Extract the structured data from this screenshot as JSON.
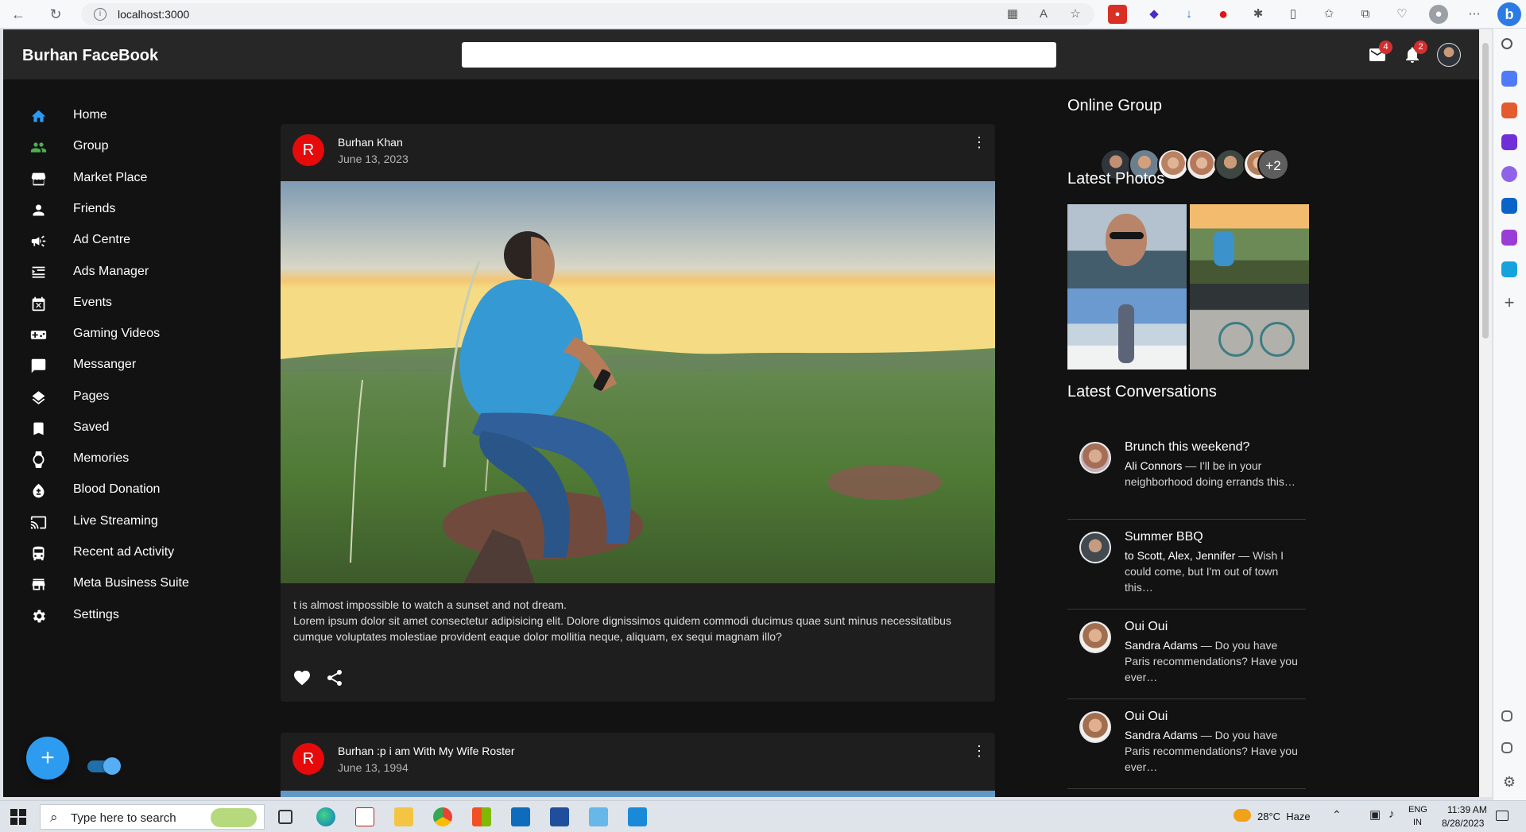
{
  "browser": {
    "url": "localhost:3000",
    "back_icon": "arrow-left-icon",
    "reload_icon": "reload-icon",
    "bing_label": "b"
  },
  "app": {
    "brand": "Burhan FaceBook",
    "search_placeholder": "",
    "mail_badge": "4",
    "notification_badge": "2"
  },
  "nav": {
    "items": [
      {
        "label": "Home",
        "icon": "home-icon"
      },
      {
        "label": "Group",
        "icon": "group-icon"
      },
      {
        "label": "Market Place",
        "icon": "store-icon"
      },
      {
        "label": "Friends",
        "icon": "person-icon"
      },
      {
        "label": "Ad Centre",
        "icon": "campaign-icon"
      },
      {
        "label": "Ads Manager",
        "icon": "list-icon"
      },
      {
        "label": "Events",
        "icon": "event-icon"
      },
      {
        "label": "Gaming Videos",
        "icon": "gamepad-icon"
      },
      {
        "label": "Messanger",
        "icon": "message-icon"
      },
      {
        "label": "Pages",
        "icon": "layers-icon"
      },
      {
        "label": "Saved",
        "icon": "bookmark-icon"
      },
      {
        "label": "Memories",
        "icon": "watch-icon"
      },
      {
        "label": "Blood Donation",
        "icon": "bloodtype-icon"
      },
      {
        "label": "Live Streaming",
        "icon": "cast-icon"
      },
      {
        "label": "Recent ad Activity",
        "icon": "activity-icon"
      },
      {
        "label": "Meta Business Suite",
        "icon": "business-icon"
      },
      {
        "label": "Settings",
        "icon": "settings-icon"
      }
    ],
    "fab_label": "+"
  },
  "posts": [
    {
      "avatar_letter": "R",
      "author": "Burhan Khan",
      "date": "June 13, 2023",
      "text_line_1": "t is almost impossible to watch a sunset and not dream.",
      "text_line_2": "Lorem ipsum dolor sit amet consectetur adipisicing elit. Dolore dignissimos quidem commodi ducimus quae sunt minus necessitatibus cumque voluptates molestiae provident eaque dolor mollitia neque, aliquam, ex sequi magnam illo?"
    },
    {
      "avatar_letter": "R",
      "author": "Burhan :p i am With My Wife Roster",
      "date": "June 13, 1994"
    }
  ],
  "right": {
    "online_group_title": "Online Group",
    "online_more": "+2",
    "latest_photos_title": "Latest Photos",
    "latest_conversations_title": "Latest Conversations",
    "conversations": [
      {
        "title": "Brunch this weekend?",
        "sender": "Ali Connors",
        "message": " — I'll be in your neighborhood doing errands this…"
      },
      {
        "title": "Summer BBQ",
        "sender": "to Scott, Alex, Jennifer",
        "message": " — Wish I could come, but I'm out of town this…"
      },
      {
        "title": "Oui Oui",
        "sender": "Sandra Adams",
        "message": " — Do you have Paris recommendations? Have you ever…"
      },
      {
        "title": "Oui Oui",
        "sender": "Sandra Adams",
        "message": " — Do you have Paris recommendations? Have you ever…"
      }
    ]
  },
  "taskbar": {
    "search_placeholder": "Type here to search",
    "weather": "28°C  Haze",
    "language_1": "ENG",
    "language_2": "IN",
    "time": "11:39 AM",
    "date": "8/28/2023"
  },
  "colors": {
    "app_background": "#121212",
    "app_bar": "#272727",
    "card": "#1e1e1e",
    "accent": "#2d9bf0",
    "avatar_red": "#e60a0a",
    "badge_red": "#d32f2f"
  }
}
